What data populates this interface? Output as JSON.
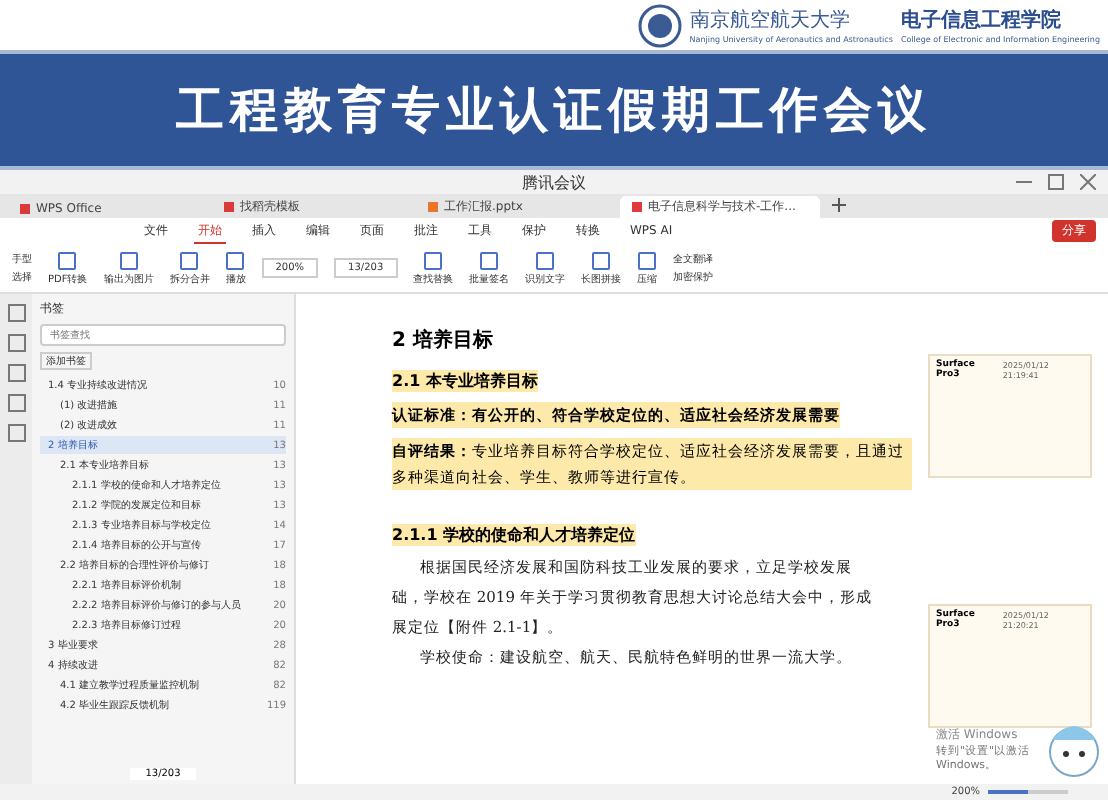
{
  "header": {
    "university": "南京航空航天大学",
    "university_en": "Nanjing University of Aeronautics and Astronautics",
    "college": "电子信息工程学院",
    "college_en": "College of Electronic and Information Engineering"
  },
  "banner": {
    "title": "工程教育专业认证假期工作会议"
  },
  "window": {
    "title": "腾讯会议"
  },
  "tabs": [
    {
      "label": "WPS Office",
      "selected": false,
      "kind": "home"
    },
    {
      "label": "找稻壳模板",
      "selected": false,
      "kind": "doc"
    },
    {
      "label": "工作汇报.pptx",
      "selected": false,
      "kind": "ppt"
    },
    {
      "label": "电子信息科学与技术-工作...",
      "selected": true,
      "kind": "pdf"
    }
  ],
  "menu": [
    {
      "label": "文件",
      "selected": false
    },
    {
      "label": "开始",
      "selected": true
    },
    {
      "label": "插入",
      "selected": false
    },
    {
      "label": "编辑",
      "selected": false
    },
    {
      "label": "页面",
      "selected": false
    },
    {
      "label": "批注",
      "selected": false
    },
    {
      "label": "工具",
      "selected": false
    },
    {
      "label": "保护",
      "selected": false
    },
    {
      "label": "转换",
      "selected": false
    },
    {
      "label": "WPS AI",
      "selected": false
    }
  ],
  "share_button": "分享",
  "toolbar": {
    "left": [
      "手型",
      "选择"
    ],
    "buttons": [
      "PDF转换",
      "输出为图片",
      "拆分合并",
      "播放"
    ],
    "zoom": "200%",
    "page": "13/203",
    "right": [
      "查找替换",
      "批量签名",
      "识别文字",
      "长图拼接",
      "压缩"
    ],
    "extra": [
      "全文翻译",
      "加密保护"
    ]
  },
  "sidebar": {
    "title": "书签",
    "search": {
      "placeholder": "书签查找"
    },
    "filter": "添加书签",
    "items": [
      {
        "label": "1.4 专业持续改进情况",
        "page": "10",
        "selected": false,
        "children": [
          {
            "label": "(1) 改进措施",
            "page": "11",
            "selected": false
          },
          {
            "label": "(2) 改进成效",
            "page": "11",
            "selected": false
          }
        ]
      },
      {
        "label": "2 培养目标",
        "page": "13",
        "selected": true,
        "children": [
          {
            "label": "2.1 本专业培养目标",
            "page": "13",
            "selected": false,
            "children": [
              {
                "label": "2.1.1 学校的使命和人才培养定位",
                "page": "13",
                "selected": false
              },
              {
                "label": "2.1.2 学院的发展定位和目标",
                "page": "13",
                "selected": false
              },
              {
                "label": "2.1.3 专业培养目标与学校定位",
                "page": "14",
                "selected": false
              },
              {
                "label": "2.1.4 培养目标的公开与宣传",
                "page": "17",
                "selected": false
              }
            ]
          },
          {
            "label": "2.2 培养目标的合理性评价与修订",
            "page": "18",
            "selected": false,
            "children": [
              {
                "label": "2.2.1 培养目标评价机制",
                "page": "18",
                "selected": false
              },
              {
                "label": "2.2.2 培养目标评价与修订的参与人员",
                "page": "20",
                "selected": false
              },
              {
                "label": "2.2.3 培养目标修订过程",
                "page": "20",
                "selected": false
              }
            ]
          }
        ]
      },
      {
        "label": "3 毕业要求",
        "page": "28",
        "selected": false
      },
      {
        "label": "4 持续改进",
        "page": "82",
        "selected": false,
        "children": [
          {
            "label": "4.1 建立教学过程质量监控机制",
            "page": "82",
            "selected": false
          },
          {
            "label": "4.2 毕业生跟踪反馈机制",
            "page": "119",
            "selected": false
          }
        ]
      }
    ],
    "page": "13/203"
  },
  "document": {
    "heading": "2  培养目标",
    "section": "2.1  本专业培养目标",
    "paragraphs": [
      {
        "kind": "labeled",
        "label": "认证标准：",
        "text": "有公开的、符合学校定位的、适应社会经济发展需要"
      },
      {
        "kind": "labeled",
        "label": "自评结果：",
        "text": "专业培养目标符合学校定位、适应社会经济发展需要，且通过多种渠道向社会、学生、教师等进行宣传。"
      }
    ],
    "subsection": "2.1.1 学校的使命和人才培养定位",
    "body": [
      "根据国民经济发展和国防科技工业发展的要求，立足学校发展",
      "础，学校在 2019 年关于学习贯彻教育思想大讨论总结大会中，形成",
      "展定位【附件 2.1-1】。",
      "学校使命：建设航空、航天、民航特色鲜明的世界一流大学。"
    ]
  },
  "comments": [
    {
      "author": "Surface Pro3",
      "time": "2025/01/12 21:19:41"
    },
    {
      "author": "Surface Pro3",
      "time": "2025/01/12 21:20:21"
    }
  ],
  "status_bar": {
    "zoom": "200%"
  },
  "watermark": {
    "title": "激活 Windows",
    "hint": "转到\"设置\"以激活 Windows。"
  }
}
